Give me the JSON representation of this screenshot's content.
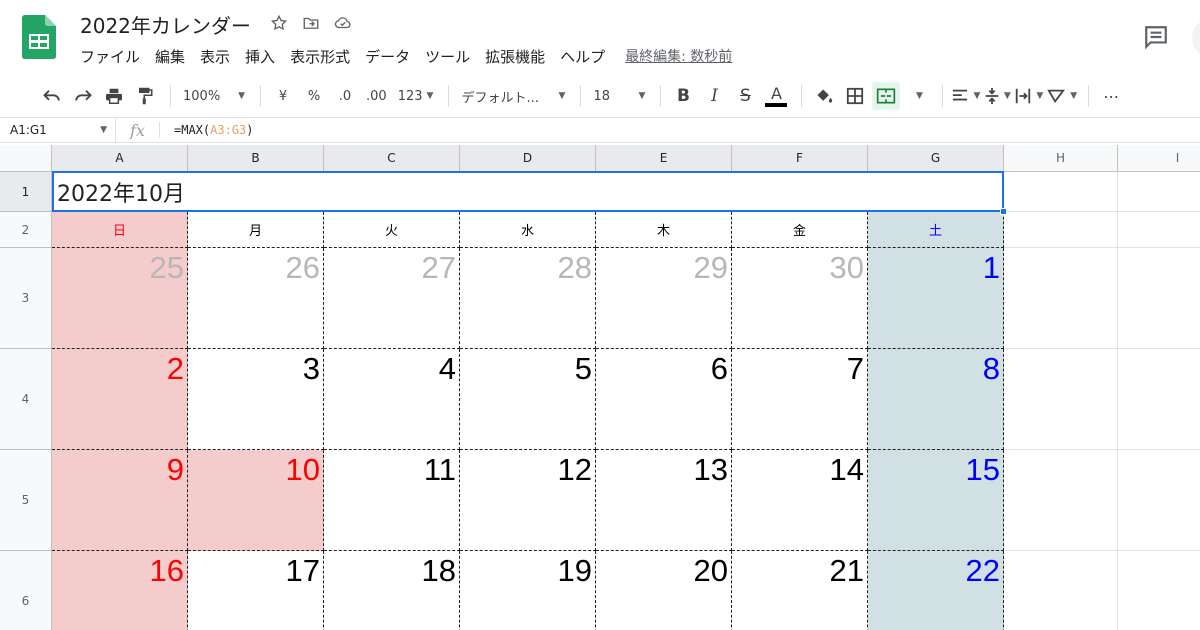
{
  "doc": {
    "title": "2022年カレンダー",
    "last_edit": "最終編集: 数秒前"
  },
  "menu": [
    "ファイル",
    "編集",
    "表示",
    "挿入",
    "表示形式",
    "データ",
    "ツール",
    "拡張機能",
    "ヘルプ"
  ],
  "toolbar": {
    "zoom": "100%",
    "currency": "¥",
    "percent": "%",
    "dec_decrease": ".0",
    "dec_increase": ".00",
    "more_formats": "123",
    "font": "デフォルト...",
    "font_size": "18",
    "bold": "B",
    "italic": "I",
    "strike": "S",
    "text_color": "A",
    "more": "⋯",
    "text_color_bar": "#000000",
    "merge_active_color": "#188038"
  },
  "formula_bar": {
    "name_box": "A1:G1",
    "fx": "fx",
    "formula_prefix": "=MAX(",
    "formula_ref": "A3:G3",
    "formula_suffix": ")"
  },
  "columns": [
    "A",
    "B",
    "C",
    "D",
    "E",
    "F",
    "G",
    "H",
    "I"
  ],
  "rows": [
    "1",
    "2",
    "3",
    "4",
    "5",
    "6"
  ],
  "calendar": {
    "title": "2022年10月",
    "weekdays": [
      "日",
      "月",
      "火",
      "水",
      "木",
      "金",
      "土"
    ],
    "weeks": [
      [
        "25",
        "26",
        "27",
        "28",
        "29",
        "30",
        "1"
      ],
      [
        "2",
        "3",
        "4",
        "5",
        "6",
        "7",
        "8"
      ],
      [
        "9",
        "10",
        "11",
        "12",
        "13",
        "14",
        "15"
      ],
      [
        "16",
        "17",
        "18",
        "19",
        "20",
        "21",
        "22"
      ]
    ],
    "other_month_week0_cols": [
      0,
      1,
      2,
      3,
      4,
      5
    ],
    "holiday_cells": [
      [
        2,
        1
      ]
    ],
    "colors": {
      "sunday_bg": "#f4cccc",
      "saturday_bg": "#d0e0e3",
      "sunday_text": "#ff0000",
      "saturday_text": "#0000ff",
      "other_month_text": "#b7b7b7",
      "normal_text": "#000000"
    }
  }
}
